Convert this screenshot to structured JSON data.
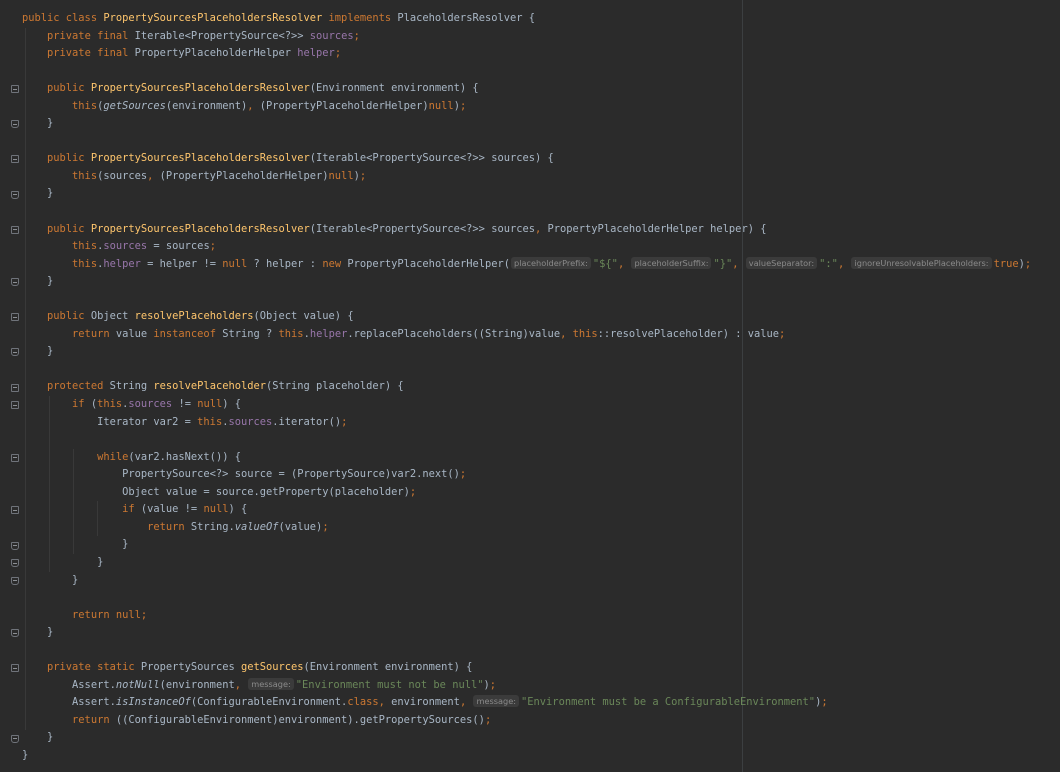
{
  "colors": {
    "background": "#2b2b2b",
    "default_text": "#a9b7c6",
    "keyword": "#cc7832",
    "field": "#9876aa",
    "method_declaration": "#ffc66d",
    "string": "#6a8759",
    "inlay_hint": "#8a8a8a"
  },
  "editor": {
    "language": "Java",
    "lines": [
      [
        [
          "kw",
          "public class "
        ],
        [
          "fn",
          "PropertySourcesPlaceholdersResolver "
        ],
        [
          "kw",
          "implements "
        ],
        [
          "t",
          "PlaceholdersResolver {"
        ]
      ],
      [
        [
          "t",
          "    "
        ],
        [
          "kw",
          "private final "
        ],
        [
          "t",
          "Iterable<PropertySource<?>> "
        ],
        [
          "fld",
          "sources"
        ],
        [
          "kw",
          ";"
        ]
      ],
      [
        [
          "t",
          "    "
        ],
        [
          "kw",
          "private final "
        ],
        [
          "t",
          "PropertyPlaceholderHelper "
        ],
        [
          "fld",
          "helper"
        ],
        [
          "kw",
          ";"
        ]
      ],
      [],
      [
        [
          "t",
          "    "
        ],
        [
          "kw",
          "public "
        ],
        [
          "fn",
          "PropertySourcesPlaceholdersResolver"
        ],
        [
          "t",
          "(Environment environment) {"
        ]
      ],
      [
        [
          "t",
          "        "
        ],
        [
          "kw",
          "this"
        ],
        [
          "t",
          "("
        ],
        [
          "it",
          "getSources"
        ],
        [
          "t",
          "(environment)"
        ],
        [
          "kw",
          ", "
        ],
        [
          "t",
          "(PropertyPlaceholderHelper)"
        ],
        [
          "kw",
          "null"
        ],
        [
          "t",
          ")"
        ],
        [
          "kw",
          ";"
        ]
      ],
      [
        [
          "t",
          "    }"
        ]
      ],
      [],
      [
        [
          "t",
          "    "
        ],
        [
          "kw",
          "public "
        ],
        [
          "fn",
          "PropertySourcesPlaceholdersResolver"
        ],
        [
          "t",
          "(Iterable<PropertySource<?>> sources) {"
        ]
      ],
      [
        [
          "t",
          "        "
        ],
        [
          "kw",
          "this"
        ],
        [
          "t",
          "(sources"
        ],
        [
          "kw",
          ", "
        ],
        [
          "t",
          "(PropertyPlaceholderHelper)"
        ],
        [
          "kw",
          "null"
        ],
        [
          "t",
          ")"
        ],
        [
          "kw",
          ";"
        ]
      ],
      [
        [
          "t",
          "    }"
        ]
      ],
      [],
      [
        [
          "t",
          "    "
        ],
        [
          "kw",
          "public "
        ],
        [
          "fn",
          "PropertySourcesPlaceholdersResolver"
        ],
        [
          "t",
          "(Iterable<PropertySource<?>> sources"
        ],
        [
          "kw",
          ", "
        ],
        [
          "t",
          "PropertyPlaceholderHelper helper) {"
        ]
      ],
      [
        [
          "t",
          "        "
        ],
        [
          "kw",
          "this"
        ],
        [
          "t",
          "."
        ],
        [
          "fld",
          "sources"
        ],
        [
          "t",
          " = sources"
        ],
        [
          "kw",
          ";"
        ]
      ],
      [
        [
          "t",
          "        "
        ],
        [
          "kw",
          "this"
        ],
        [
          "t",
          "."
        ],
        [
          "fld",
          "helper"
        ],
        [
          "t",
          " = helper != "
        ],
        [
          "kw",
          "null "
        ],
        [
          "t",
          "? helper : "
        ],
        [
          "kw",
          "new "
        ],
        [
          "t",
          "PropertyPlaceholderHelper("
        ],
        [
          "hint",
          "placeholderPrefix:"
        ],
        [
          "str",
          "\"${\""
        ],
        [
          "kw",
          ", "
        ],
        [
          "hint",
          "placeholderSuffix:"
        ],
        [
          "str",
          "\"}\""
        ],
        [
          "kw",
          ", "
        ],
        [
          "hint",
          "valueSeparator:"
        ],
        [
          "str",
          "\":\""
        ],
        [
          "kw",
          ", "
        ],
        [
          "hint",
          "ignoreUnresolvablePlaceholders:"
        ],
        [
          "kw",
          "true"
        ],
        [
          "t",
          ")"
        ],
        [
          "kw",
          ";"
        ]
      ],
      [
        [
          "t",
          "    }"
        ]
      ],
      [],
      [
        [
          "t",
          "    "
        ],
        [
          "kw",
          "public "
        ],
        [
          "t",
          "Object "
        ],
        [
          "fn",
          "resolvePlaceholders"
        ],
        [
          "t",
          "(Object value) {"
        ]
      ],
      [
        [
          "t",
          "        "
        ],
        [
          "kw",
          "return "
        ],
        [
          "t",
          "value "
        ],
        [
          "kw",
          "instanceof "
        ],
        [
          "t",
          "String ? "
        ],
        [
          "kw",
          "this"
        ],
        [
          "t",
          "."
        ],
        [
          "fld",
          "helper"
        ],
        [
          "t",
          ".replacePlaceholders((String)value"
        ],
        [
          "kw",
          ", this"
        ],
        [
          "t",
          "::resolvePlaceholder) : value"
        ],
        [
          "kw",
          ";"
        ]
      ],
      [
        [
          "t",
          "    }"
        ]
      ],
      [],
      [
        [
          "t",
          "    "
        ],
        [
          "kw",
          "protected "
        ],
        [
          "t",
          "String "
        ],
        [
          "fn",
          "resolvePlaceholder"
        ],
        [
          "t",
          "(String placeholder) {"
        ]
      ],
      [
        [
          "t",
          "        "
        ],
        [
          "kw",
          "if "
        ],
        [
          "t",
          "("
        ],
        [
          "kw",
          "this"
        ],
        [
          "t",
          "."
        ],
        [
          "fld",
          "sources"
        ],
        [
          "t",
          " != "
        ],
        [
          "kw",
          "null"
        ],
        [
          "t",
          ") {"
        ]
      ],
      [
        [
          "t",
          "            Iterator var2 = "
        ],
        [
          "kw",
          "this"
        ],
        [
          "t",
          "."
        ],
        [
          "fld",
          "sources"
        ],
        [
          "t",
          ".iterator()"
        ],
        [
          "kw",
          ";"
        ]
      ],
      [],
      [
        [
          "t",
          "            "
        ],
        [
          "kw",
          "while"
        ],
        [
          "t",
          "(var2.hasNext()) {"
        ]
      ],
      [
        [
          "t",
          "                PropertySource<?> source = (PropertySource)var2.next()"
        ],
        [
          "kw",
          ";"
        ]
      ],
      [
        [
          "t",
          "                Object value = source.getProperty(placeholder)"
        ],
        [
          "kw",
          ";"
        ]
      ],
      [
        [
          "t",
          "                "
        ],
        [
          "kw",
          "if "
        ],
        [
          "t",
          "(value != "
        ],
        [
          "kw",
          "null"
        ],
        [
          "t",
          ") {"
        ]
      ],
      [
        [
          "t",
          "                    "
        ],
        [
          "kw",
          "return "
        ],
        [
          "t",
          "String."
        ],
        [
          "it",
          "valueOf"
        ],
        [
          "t",
          "(value)"
        ],
        [
          "kw",
          ";"
        ]
      ],
      [
        [
          "t",
          "                }"
        ]
      ],
      [
        [
          "t",
          "            }"
        ]
      ],
      [
        [
          "t",
          "        }"
        ]
      ],
      [],
      [
        [
          "t",
          "        "
        ],
        [
          "kw",
          "return null;"
        ]
      ],
      [
        [
          "t",
          "    }"
        ]
      ],
      [],
      [
        [
          "t",
          "    "
        ],
        [
          "kw",
          "private static "
        ],
        [
          "t",
          "PropertySources "
        ],
        [
          "fn",
          "getSources"
        ],
        [
          "t",
          "(Environment environment) {"
        ]
      ],
      [
        [
          "t",
          "        Assert."
        ],
        [
          "it",
          "notNull"
        ],
        [
          "t",
          "(environment"
        ],
        [
          "kw",
          ", "
        ],
        [
          "hint",
          "message:"
        ],
        [
          "str",
          "\"Environment must not be null\""
        ],
        [
          "t",
          ")"
        ],
        [
          "kw",
          ";"
        ]
      ],
      [
        [
          "t",
          "        Assert."
        ],
        [
          "it",
          "isInstanceOf"
        ],
        [
          "t",
          "(ConfigurableEnvironment."
        ],
        [
          "kw",
          "class, "
        ],
        [
          "t",
          "environment"
        ],
        [
          "kw",
          ", "
        ],
        [
          "hint",
          "message:"
        ],
        [
          "str",
          "\"Environment must be a ConfigurableEnvironment\""
        ],
        [
          "t",
          ")"
        ],
        [
          "kw",
          ";"
        ]
      ],
      [
        [
          "t",
          "        "
        ],
        [
          "kw",
          "return "
        ],
        [
          "t",
          "((ConfigurableEnvironment)environment).getPropertySources()"
        ],
        [
          "kw",
          ";"
        ]
      ],
      [
        [
          "t",
          "    }"
        ]
      ],
      [
        [
          "t",
          "}"
        ]
      ]
    ],
    "fold_markers": [
      {
        "line": 5,
        "kind": "open"
      },
      {
        "line": 7,
        "kind": "close"
      },
      {
        "line": 9,
        "kind": "open"
      },
      {
        "line": 11,
        "kind": "close"
      },
      {
        "line": 13,
        "kind": "open"
      },
      {
        "line": 16,
        "kind": "close"
      },
      {
        "line": 18,
        "kind": "open"
      },
      {
        "line": 20,
        "kind": "close"
      },
      {
        "line": 22,
        "kind": "open"
      },
      {
        "line": 23,
        "kind": "open"
      },
      {
        "line": 26,
        "kind": "open"
      },
      {
        "line": 29,
        "kind": "open"
      },
      {
        "line": 31,
        "kind": "close"
      },
      {
        "line": 32,
        "kind": "close"
      },
      {
        "line": 33,
        "kind": "close"
      },
      {
        "line": 36,
        "kind": "close"
      },
      {
        "line": 38,
        "kind": "open"
      },
      {
        "line": 42,
        "kind": "close"
      }
    ]
  }
}
